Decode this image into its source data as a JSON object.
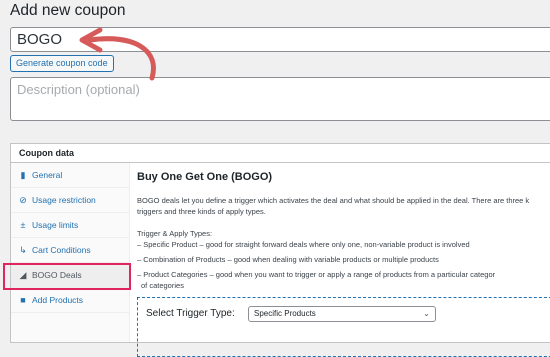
{
  "page": {
    "title": "Add new coupon"
  },
  "coupon": {
    "code_value": "BOGO",
    "generate_button": "Generate coupon code",
    "description_placeholder": "Description (optional)"
  },
  "colors": {
    "accent": "#2271b1",
    "highlight": "#e0245e",
    "annotation_arrow": "#d65a5a"
  },
  "panel": {
    "heading": "Coupon data",
    "tabs": [
      {
        "label": "General",
        "icon": "ticket-icon"
      },
      {
        "label": "Usage restriction",
        "icon": "block-icon"
      },
      {
        "label": "Usage limits",
        "icon": "plus-minus-icon"
      },
      {
        "label": "Cart Conditions",
        "icon": "cart-icon"
      },
      {
        "label": "BOGO Deals",
        "icon": "megaphone-icon",
        "active": true
      },
      {
        "label": "Add Products",
        "icon": "package-icon"
      }
    ]
  },
  "bogo": {
    "title": "Buy One Get One (BOGO)",
    "intro_line1": "BOGO deals let you define a trigger which activates the deal and what should be applied in the deal. There are three k",
    "intro_line2": "triggers and three kinds of apply types.",
    "types_heading": "Trigger & Apply Types:",
    "bullets": [
      "– Specific Product – good for straight forward deals where only one, non-variable product is involved",
      "– Combination of Products – good when dealing with variable products or multiple products",
      "– Product Categories – good when you want to trigger or apply a range of products from a particular categor"
    ],
    "bullet3_continuation": "of categories",
    "trigger_label": "Select Trigger Type:",
    "trigger_value": "Specific Products"
  }
}
